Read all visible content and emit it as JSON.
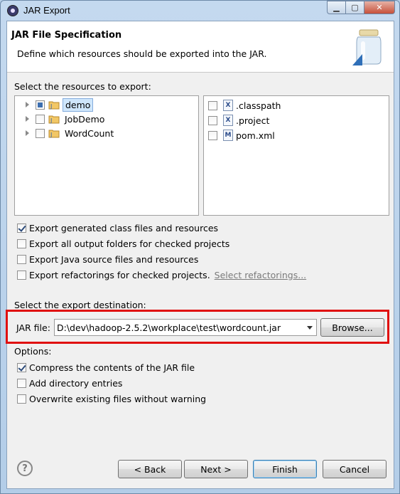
{
  "window": {
    "title": "JAR Export"
  },
  "header": {
    "title": "JAR File Specification",
    "description": "Define which resources should be exported into the JAR."
  },
  "resources": {
    "label": "Select the resources to export:",
    "tree": [
      {
        "label": "demo",
        "state": "partial",
        "selected": true
      },
      {
        "label": "JobDemo",
        "state": "unchecked",
        "selected": false
      },
      {
        "label": "WordCount",
        "state": "unchecked",
        "selected": false
      }
    ],
    "files": [
      {
        "label": ".classpath",
        "icon": "X"
      },
      {
        "label": ".project",
        "icon": "X"
      },
      {
        "label": "pom.xml",
        "icon": "M"
      }
    ]
  },
  "export_options": [
    {
      "label": "Export generated class files and resources",
      "checked": true
    },
    {
      "label": "Export all output folders for checked projects",
      "checked": false
    },
    {
      "label": "Export Java source files and resources",
      "checked": false
    },
    {
      "label": "Export refactorings for checked projects.",
      "checked": false,
      "link": "Select refactorings..."
    }
  ],
  "destination": {
    "label": "Select the export destination:",
    "jar_file_label": "JAR file:",
    "jar_file_value": "D:\\dev\\hadoop-2.5.2\\workplace\\test\\wordcount.jar",
    "browse_label": "Browse..."
  },
  "options": {
    "label": "Options:",
    "items": [
      {
        "label": "Compress the contents of the JAR file",
        "checked": true
      },
      {
        "label": "Add directory entries",
        "checked": false
      },
      {
        "label": "Overwrite existing files without warning",
        "checked": false
      }
    ]
  },
  "buttons": {
    "back": "< Back",
    "next": "Next >",
    "finish": "Finish",
    "cancel": "Cancel"
  }
}
